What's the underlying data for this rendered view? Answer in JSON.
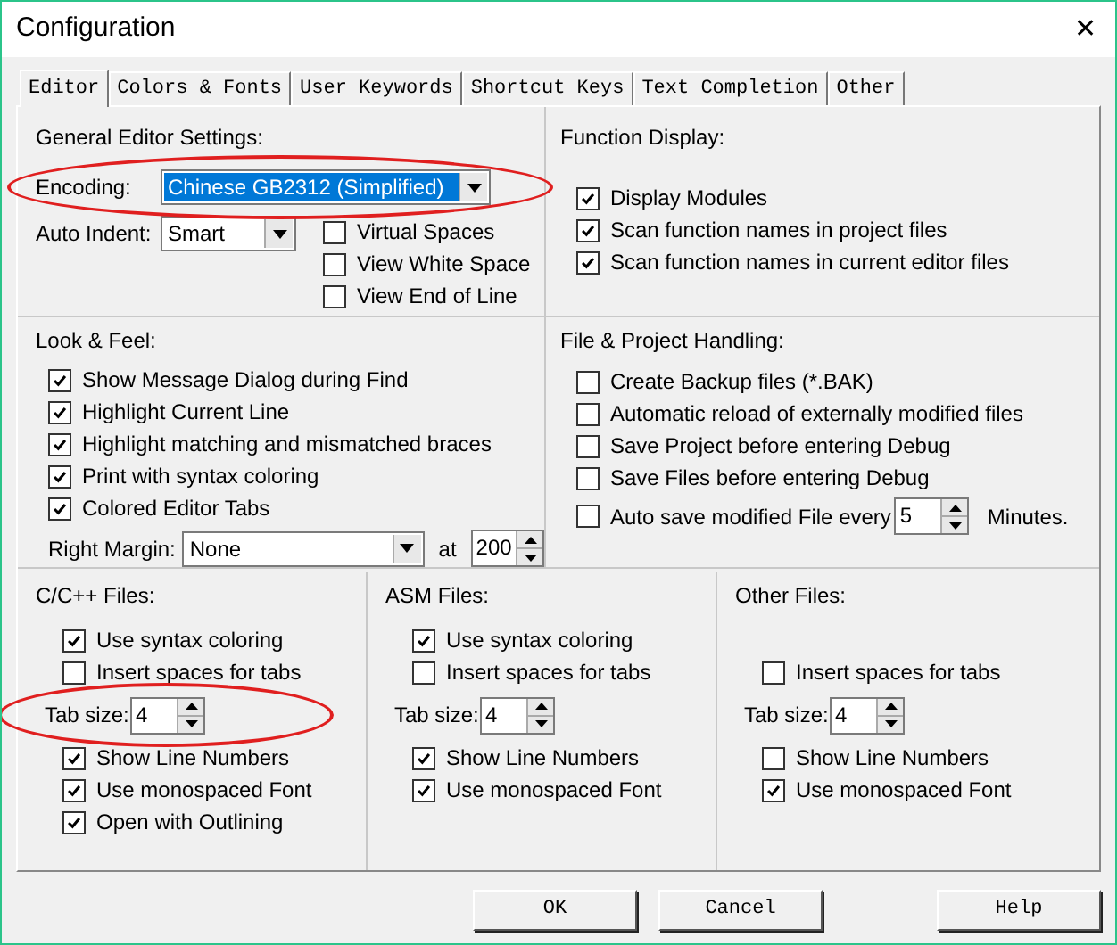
{
  "window": {
    "title": "Configuration",
    "close": "✕"
  },
  "tabs": [
    {
      "label": "Editor",
      "selected": true
    },
    {
      "label": "Colors & Fonts",
      "selected": false
    },
    {
      "label": "User Keywords",
      "selected": false
    },
    {
      "label": "Shortcut Keys",
      "selected": false
    },
    {
      "label": "Text Completion",
      "selected": false
    },
    {
      "label": "Other",
      "selected": false
    }
  ],
  "general": {
    "title": "General Editor Settings:",
    "encoding": {
      "label": "Encoding:",
      "value": "Chinese GB2312 (Simplified)",
      "highlighted": true,
      "circled": true
    },
    "auto_indent": {
      "label": "Auto Indent:",
      "value": "Smart"
    },
    "checks": [
      {
        "label": "Virtual Spaces",
        "checked": false
      },
      {
        "label": "View White Space",
        "checked": false
      },
      {
        "label": "View End of Line",
        "checked": false
      }
    ]
  },
  "function_display": {
    "title": "Function Display:",
    "checks": [
      {
        "label": "Display Modules",
        "checked": true
      },
      {
        "label": "Scan function names in project files",
        "checked": true
      },
      {
        "label": "Scan function names in current editor files",
        "checked": true
      }
    ]
  },
  "look_feel": {
    "title": "Look & Feel:",
    "checks": [
      {
        "label": "Show Message Dialog during Find",
        "checked": true
      },
      {
        "label": "Highlight Current Line",
        "checked": true
      },
      {
        "label": "Highlight matching and mismatched braces",
        "checked": true
      },
      {
        "label": "Print with syntax coloring",
        "checked": true
      },
      {
        "label": "Colored Editor Tabs",
        "checked": true
      }
    ],
    "right_margin": {
      "label": "Right Margin:",
      "value": "None",
      "at_label": "at",
      "at_value": "200"
    }
  },
  "file_handling": {
    "title": "File & Project Handling:",
    "checks": [
      {
        "label": "Create Backup files (*.BAK)",
        "checked": false
      },
      {
        "label": "Automatic reload of externally modified files",
        "checked": false
      },
      {
        "label": "Save Project before entering Debug",
        "checked": false
      },
      {
        "label": "Save Files before entering Debug",
        "checked": false
      }
    ],
    "auto_save": {
      "label": "Auto save modified File every",
      "checked": false,
      "value": "5",
      "unit": "Minutes."
    }
  },
  "file_types": [
    {
      "title": "C/C++ Files:",
      "items": [
        {
          "kind": "check",
          "label": "Use syntax coloring",
          "checked": true
        },
        {
          "kind": "check",
          "label": "Insert spaces for tabs",
          "checked": false
        },
        {
          "kind": "tabsize",
          "label": "Tab size:",
          "value": "4",
          "circled": true
        },
        {
          "kind": "check",
          "label": "Show Line Numbers",
          "checked": true
        },
        {
          "kind": "check",
          "label": "Use monospaced Font",
          "checked": true
        },
        {
          "kind": "check",
          "label": "Open with Outlining",
          "checked": true
        }
      ]
    },
    {
      "title": "ASM Files:",
      "items": [
        {
          "kind": "check",
          "label": "Use syntax coloring",
          "checked": true
        },
        {
          "kind": "check",
          "label": "Insert spaces for tabs",
          "checked": false
        },
        {
          "kind": "tabsize",
          "label": "Tab size:",
          "value": "4",
          "circled": false
        },
        {
          "kind": "check",
          "label": "Show Line Numbers",
          "checked": true
        },
        {
          "kind": "check",
          "label": "Use monospaced Font",
          "checked": true
        }
      ]
    },
    {
      "title": "Other Files:",
      "items": [
        {
          "kind": "spacer"
        },
        {
          "kind": "check",
          "label": "Insert spaces for tabs",
          "checked": false
        },
        {
          "kind": "tabsize",
          "label": "Tab size:",
          "value": "4",
          "circled": false
        },
        {
          "kind": "check",
          "label": "Show Line Numbers",
          "checked": false
        },
        {
          "kind": "check",
          "label": "Use monospaced Font",
          "checked": true
        }
      ]
    }
  ],
  "buttons": [
    "OK",
    "Cancel",
    "Help"
  ]
}
